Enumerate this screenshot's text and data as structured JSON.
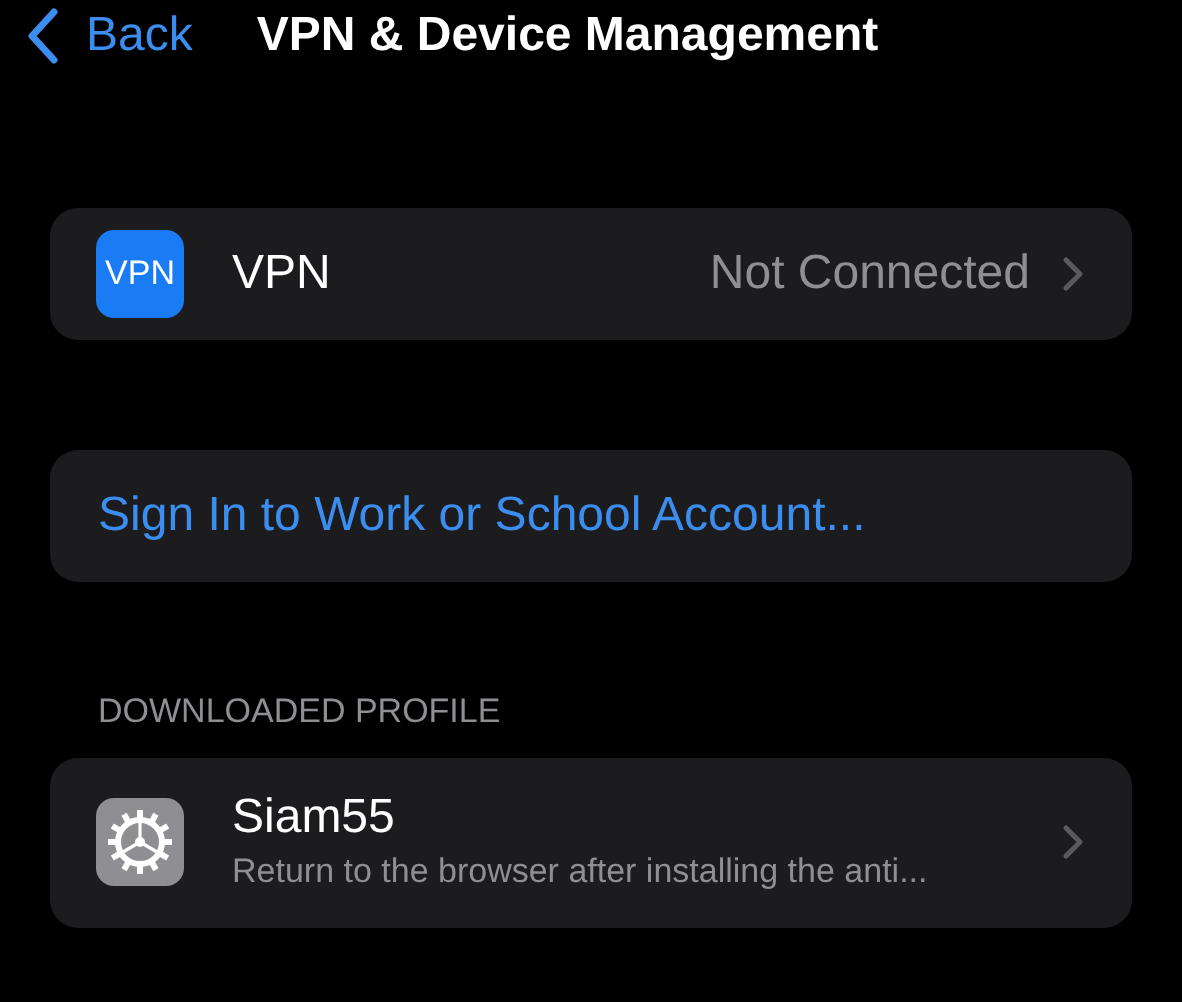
{
  "nav": {
    "back_label": "Back",
    "title": "VPN & Device Management"
  },
  "vpn_row": {
    "icon_text": "VPN",
    "label": "VPN",
    "value": "Not Connected"
  },
  "sign_in_link": "Sign In to Work or School Account...",
  "downloaded_profile": {
    "header": "DOWNLOADED PROFILE",
    "items": [
      {
        "name": "Siam55",
        "description": "Return to the browser after installing the anti..."
      }
    ]
  }
}
